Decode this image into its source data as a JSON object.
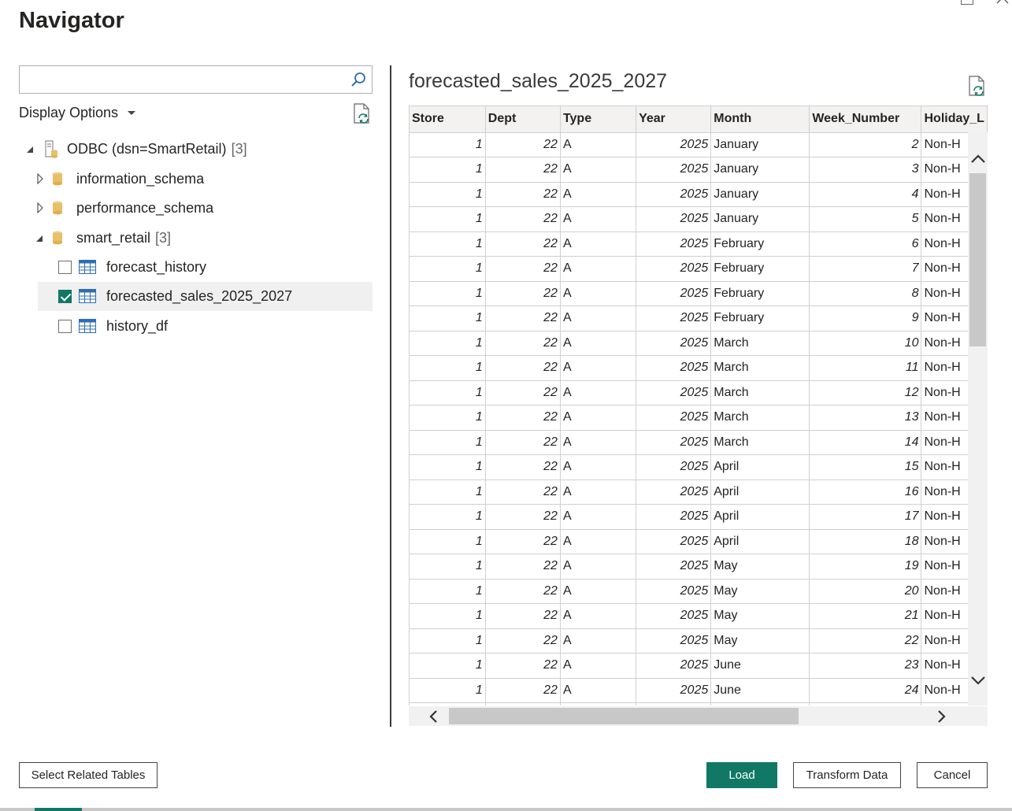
{
  "window": {
    "title": "Navigator"
  },
  "search": {
    "value": "",
    "placeholder": ""
  },
  "display_options": {
    "label": "Display Options"
  },
  "tree": {
    "root": {
      "label": "ODBC (dsn=SmartRetail)",
      "count": "[3]"
    },
    "schemas": [
      {
        "label": "information_schema",
        "expanded": false
      },
      {
        "label": "performance_schema",
        "expanded": false
      },
      {
        "label": "smart_retail",
        "count": "[3]",
        "expanded": true
      }
    ],
    "tables": [
      {
        "label": "forecast_history",
        "checked": false
      },
      {
        "label": "forecasted_sales_2025_2027",
        "checked": true,
        "selected": true
      },
      {
        "label": "history_df",
        "checked": false
      }
    ]
  },
  "preview": {
    "title": "forecasted_sales_2025_2027",
    "columns": [
      "Store",
      "Dept",
      "Type",
      "Year",
      "Month",
      "Week_Number",
      "Holiday_L"
    ],
    "rows": [
      [
        "1",
        "22",
        "A",
        "2025",
        "January",
        "2",
        "Non-H"
      ],
      [
        "1",
        "22",
        "A",
        "2025",
        "January",
        "3",
        "Non-H"
      ],
      [
        "1",
        "22",
        "A",
        "2025",
        "January",
        "4",
        "Non-H"
      ],
      [
        "1",
        "22",
        "A",
        "2025",
        "January",
        "5",
        "Non-H"
      ],
      [
        "1",
        "22",
        "A",
        "2025",
        "February",
        "6",
        "Non-H"
      ],
      [
        "1",
        "22",
        "A",
        "2025",
        "February",
        "7",
        "Non-H"
      ],
      [
        "1",
        "22",
        "A",
        "2025",
        "February",
        "8",
        "Non-H"
      ],
      [
        "1",
        "22",
        "A",
        "2025",
        "February",
        "9",
        "Non-H"
      ],
      [
        "1",
        "22",
        "A",
        "2025",
        "March",
        "10",
        "Non-H"
      ],
      [
        "1",
        "22",
        "A",
        "2025",
        "March",
        "11",
        "Non-H"
      ],
      [
        "1",
        "22",
        "A",
        "2025",
        "March",
        "12",
        "Non-H"
      ],
      [
        "1",
        "22",
        "A",
        "2025",
        "March",
        "13",
        "Non-H"
      ],
      [
        "1",
        "22",
        "A",
        "2025",
        "March",
        "14",
        "Non-H"
      ],
      [
        "1",
        "22",
        "A",
        "2025",
        "April",
        "15",
        "Non-H"
      ],
      [
        "1",
        "22",
        "A",
        "2025",
        "April",
        "16",
        "Non-H"
      ],
      [
        "1",
        "22",
        "A",
        "2025",
        "April",
        "17",
        "Non-H"
      ],
      [
        "1",
        "22",
        "A",
        "2025",
        "April",
        "18",
        "Non-H"
      ],
      [
        "1",
        "22",
        "A",
        "2025",
        "May",
        "19",
        "Non-H"
      ],
      [
        "1",
        "22",
        "A",
        "2025",
        "May",
        "20",
        "Non-H"
      ],
      [
        "1",
        "22",
        "A",
        "2025",
        "May",
        "21",
        "Non-H"
      ],
      [
        "1",
        "22",
        "A",
        "2025",
        "May",
        "22",
        "Non-H"
      ],
      [
        "1",
        "22",
        "A",
        "2025",
        "June",
        "23",
        "Non-H"
      ],
      [
        "1",
        "22",
        "A",
        "2025",
        "June",
        "24",
        "Non-H"
      ],
      [
        "",
        "",
        "",
        "",
        "",
        "",
        ""
      ]
    ]
  },
  "buttons": {
    "select_related": "Select Related Tables",
    "load": "Load",
    "transform": "Transform Data",
    "cancel": "Cancel"
  },
  "colors": {
    "accent": "#117865",
    "db_icon": "#e8c06a",
    "table_icon": "#2e6db4"
  },
  "icons": [
    "search-icon",
    "refresh-icon",
    "server-icon",
    "database-icon",
    "table-icon",
    "expand-arrow-icon",
    "collapse-arrow-icon"
  ]
}
